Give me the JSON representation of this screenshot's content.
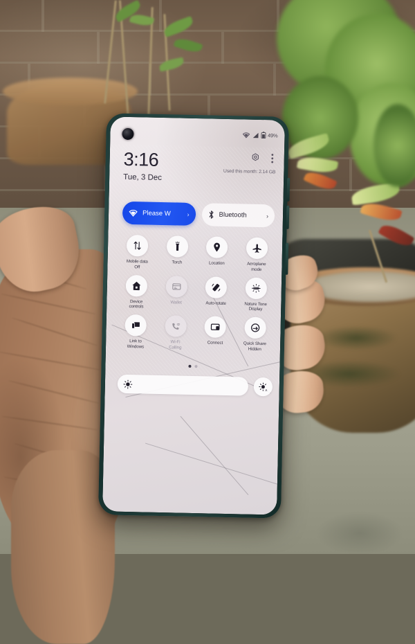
{
  "scene": {
    "description": "hand holding a smartphone outdoors in front of a brick wall with potted plants",
    "phone_frame_color": "#1e3a37",
    "ground_color": "#a7a795",
    "brick_color": "#7a6450"
  },
  "statusbar": {
    "wifi_icon": "wifi-icon",
    "signal_icon": "signal-bars-icon",
    "battery_icon": "battery-icon",
    "battery_percent": "49%"
  },
  "header": {
    "clock": "3:16",
    "date": "Tue, 3 Dec",
    "settings_icon": "gear-icon",
    "overflow_icon": "three-dots-icon",
    "data_usage": "Used this month: 2.14 GB"
  },
  "pills": [
    {
      "label": "Please W",
      "icon": "wifi-icon",
      "state": "on",
      "chevron": "›"
    },
    {
      "label": "Bluetooth",
      "icon": "bluetooth-icon",
      "state": "off",
      "chevron": "›"
    }
  ],
  "tiles": [
    {
      "label": "Mobile data\nOff",
      "icon": "mobile-data-icon",
      "dim": false
    },
    {
      "label": "Torch",
      "icon": "torch-icon",
      "dim": false
    },
    {
      "label": "Location",
      "icon": "location-pin-icon",
      "dim": false
    },
    {
      "label": "Aeroplane\nmode",
      "icon": "aeroplane-icon",
      "dim": false
    },
    {
      "label": "Device\ncontrols",
      "icon": "home-icon",
      "dim": false
    },
    {
      "label": "Wallet",
      "icon": "wallet-icon",
      "dim": true
    },
    {
      "label": "Auto-rotate",
      "icon": "auto-rotate-icon",
      "dim": false
    },
    {
      "label": "Nature Tone\nDisplay",
      "icon": "nature-tone-icon",
      "dim": false
    },
    {
      "label": "Link to\nWindows",
      "icon": "link-to-windows-icon",
      "dim": false
    },
    {
      "label": "Wi-Fi\nCalling",
      "icon": "wifi-calling-icon",
      "dim": true
    },
    {
      "label": "Connect",
      "icon": "connect-cast-icon",
      "dim": false
    },
    {
      "label": "Quick Share\nHidden",
      "icon": "quick-share-icon",
      "dim": false
    }
  ],
  "page_dots": {
    "count": 2,
    "active_index": 0
  },
  "brightness": {
    "slider_icon": "brightness-sun-icon",
    "auto_icon": "brightness-auto-icon",
    "level_percent": 100
  }
}
